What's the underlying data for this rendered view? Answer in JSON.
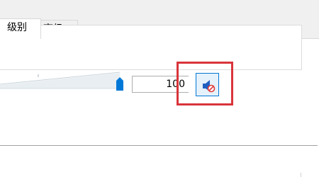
{
  "tabs": [
    {
      "label": "级别",
      "active": true
    },
    {
      "label": "高级",
      "active": false
    }
  ],
  "volume": {
    "value": "100",
    "level_percent": 100,
    "muted": true
  },
  "icons": {
    "thumb": "slider-thumb-icon",
    "mute": "speaker-muted-icon"
  },
  "colors": {
    "highlight": "#d9343a",
    "accent": "#0078d7",
    "thumb": "#0078d7"
  }
}
